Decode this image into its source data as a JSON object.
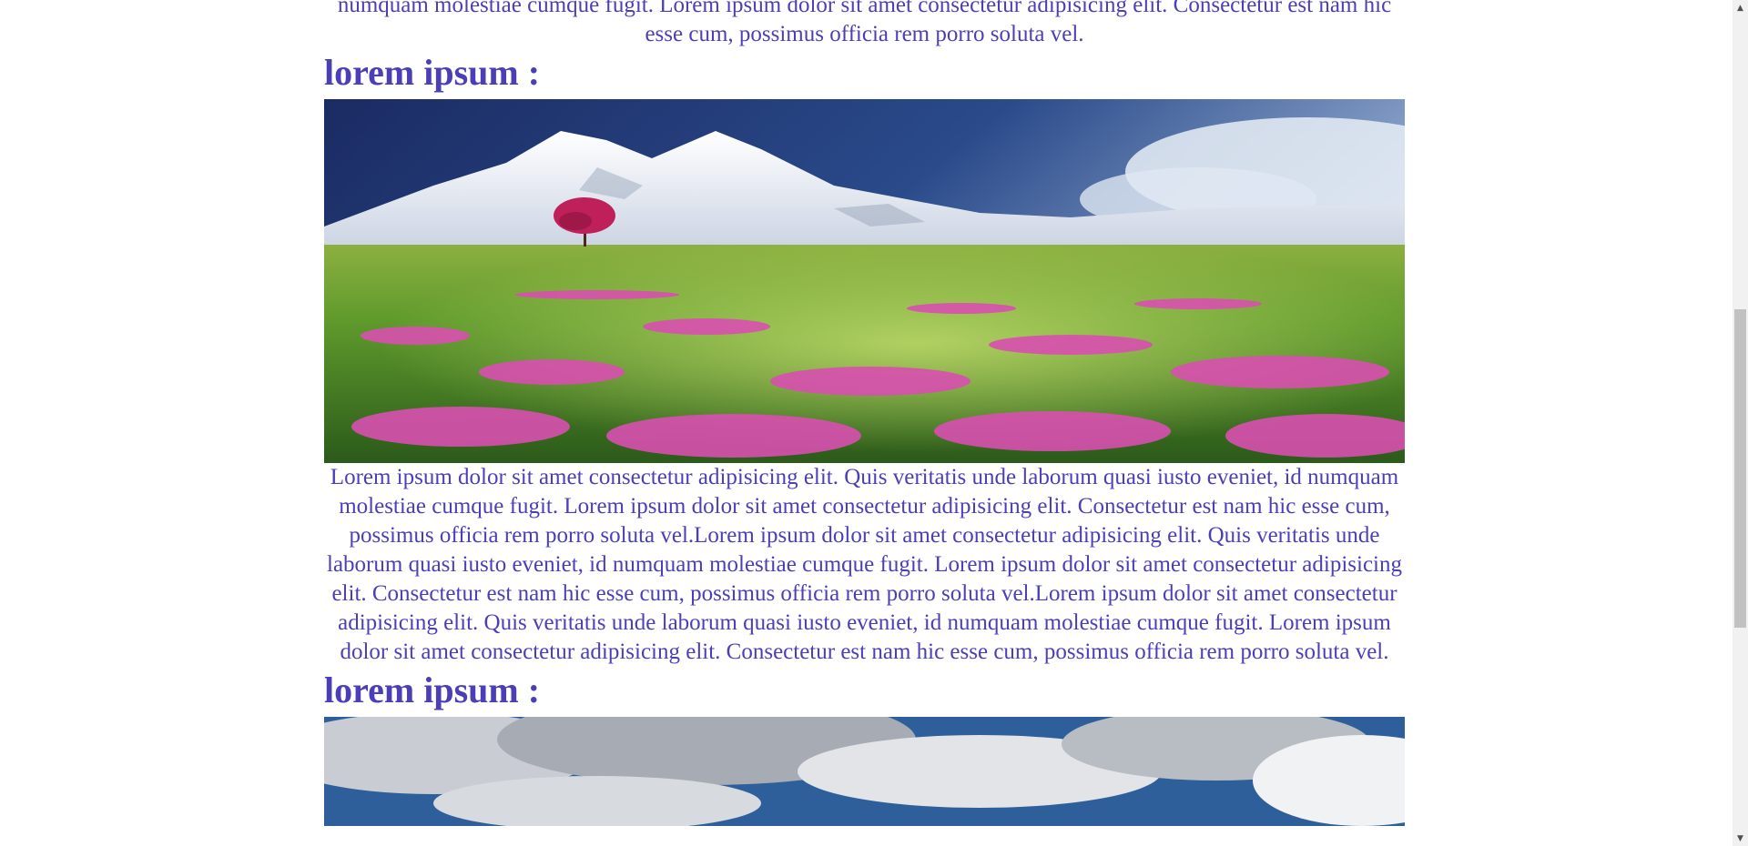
{
  "sections": {
    "para_top": "vel.Lorem ipsum dolor sit amet consectetur adipisicing elit. Quis veritatis unde laborum quasi iusto eveniet, id numquam molestiae cumque fugit. Lorem ipsum dolor sit amet consectetur adipisicing elit. Consectetur est nam hic esse cum, possimus officia rem porro soluta vel.",
    "heading_1": "lorem ipsum :",
    "para_1": "Lorem ipsum dolor sit amet consectetur adipisicing elit. Quis veritatis unde laborum quasi iusto eveniet, id numquam molestiae cumque fugit. Lorem ipsum dolor sit amet consectetur adipisicing elit. Consectetur est nam hic esse cum, possimus officia rem porro soluta vel.Lorem ipsum dolor sit amet consectetur adipisicing elit. Quis veritatis unde laborum quasi iusto eveniet, id numquam molestiae cumque fugit. Lorem ipsum dolor sit amet consectetur adipisicing elit. Consectetur est nam hic esse cum, possimus officia rem porro soluta vel.Lorem ipsum dolor sit amet consectetur adipisicing elit. Quis veritatis unde laborum quasi iusto eveniet, id numquam molestiae cumque fugit. Lorem ipsum dolor sit amet consectetur adipisicing elit. Consectetur est nam hic esse cum, possimus officia rem porro soluta vel.",
    "heading_2": "lorem ipsum :"
  },
  "colors": {
    "text": "#4b3fb8",
    "sky_dark": "#1c2e66",
    "snow": "#eef1f7",
    "meadow": "#4f8a2a",
    "flowers": "#d94fb0",
    "tree": "#c0205a"
  },
  "icons": {
    "scroll_up": "chevron-up-icon",
    "scroll_down": "chevron-down-icon"
  }
}
